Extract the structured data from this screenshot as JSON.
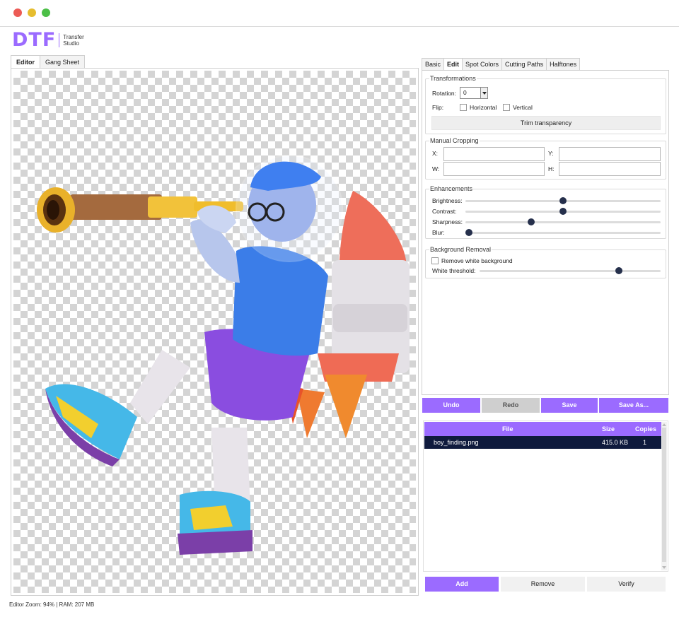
{
  "app": {
    "logo_text": "DTF",
    "logo_sub": "Transfer Studio",
    "brand_color": "#9b6bff"
  },
  "editor_tabs": [
    {
      "label": "Editor",
      "active": true
    },
    {
      "label": "Gang Sheet",
      "active": false
    }
  ],
  "edit_tabs": [
    {
      "label": "Basic",
      "active": false
    },
    {
      "label": "Edit",
      "active": true
    },
    {
      "label": "Spot Colors",
      "active": false
    },
    {
      "label": "Cutting Paths",
      "active": false
    },
    {
      "label": "Halftones",
      "active": false
    }
  ],
  "transformations": {
    "title": "Transformations",
    "rotation_label": "Rotation:",
    "rotation_value": "0",
    "flip_label": "Flip:",
    "horizontal_label": "Horizontal",
    "vertical_label": "Vertical",
    "horizontal_checked": false,
    "vertical_checked": false,
    "trim_label": "Trim transparency"
  },
  "cropping": {
    "title": "Manual Cropping",
    "x_label": "X:",
    "y_label": "Y:",
    "w_label": "W:",
    "h_label": "H:",
    "x_value": "",
    "y_value": "",
    "w_value": "",
    "h_value": ""
  },
  "enhancements": {
    "title": "Enhancements",
    "sliders": [
      {
        "label": "Brightness:",
        "value": 0.5
      },
      {
        "label": "Contrast:",
        "value": 0.5
      },
      {
        "label": "Sharpness:",
        "value": 0.33
      },
      {
        "label": "Blur:",
        "value": 0.0
      }
    ]
  },
  "background_removal": {
    "title": "Background Removal",
    "remove_white_label": "Remove white background",
    "remove_white_checked": false,
    "threshold_label": "White threshold:",
    "threshold_value": 0.78
  },
  "actions": {
    "undo": "Undo",
    "redo": "Redo",
    "save": "Save",
    "save_as": "Save As..."
  },
  "file_table": {
    "columns": [
      "File",
      "Size",
      "Copies"
    ],
    "rows": [
      {
        "file": "boy_finding.png",
        "size": "415.0 KB",
        "copies": "1",
        "selected": true
      }
    ]
  },
  "file_actions": {
    "add": "Add",
    "remove": "Remove",
    "verify": "Verify"
  },
  "status_bar": {
    "text": "Editor Zoom: 94% | RAM: 207 MB"
  }
}
